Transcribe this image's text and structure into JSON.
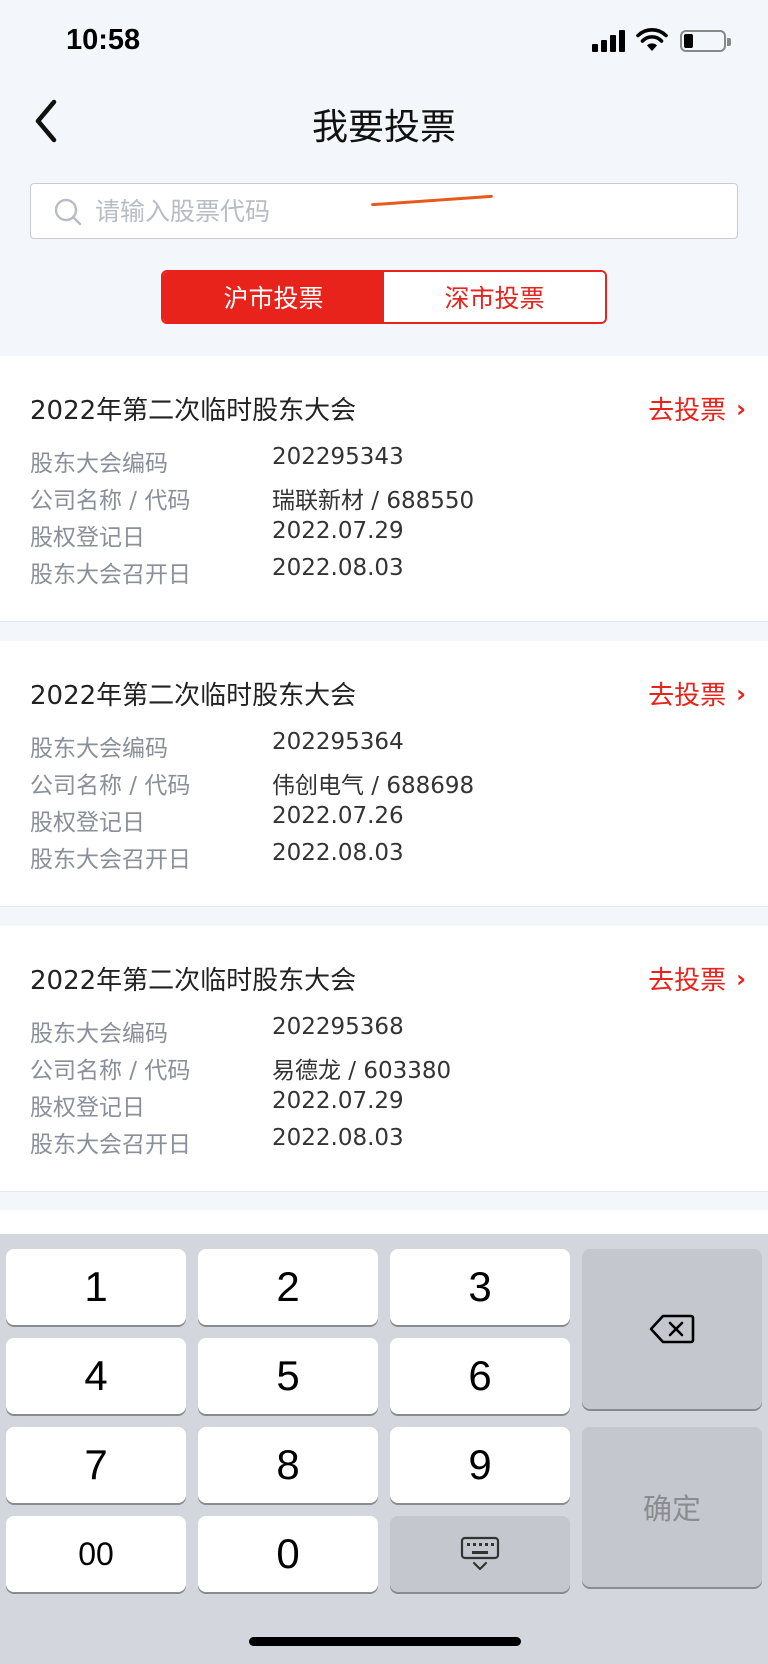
{
  "status_bar": {
    "time": "10:58"
  },
  "header": {
    "title": "我要投票"
  },
  "search": {
    "placeholder": "请输入股票代码",
    "value": ""
  },
  "tabs": [
    {
      "label": "沪市投票",
      "active": true
    },
    {
      "label": "深市投票",
      "active": false
    }
  ],
  "cards": [
    {
      "title": "2022年第二次临时股东大会",
      "action": "去投票",
      "rows": [
        {
          "key": "股东大会编码",
          "value": "202295343"
        },
        {
          "key": "公司名称 / 代码",
          "value": "瑞联新材 / 688550"
        },
        {
          "key": "股权登记日",
          "value": "2022.07.29"
        },
        {
          "key": "股东大会召开日",
          "value": "2022.08.03"
        }
      ]
    },
    {
      "title": "2022年第二次临时股东大会",
      "action": "去投票",
      "rows": [
        {
          "key": "股东大会编码",
          "value": "202295364"
        },
        {
          "key": "公司名称 / 代码",
          "value": "伟创电气 / 688698"
        },
        {
          "key": "股权登记日",
          "value": "2022.07.26"
        },
        {
          "key": "股东大会召开日",
          "value": "2022.08.03"
        }
      ]
    },
    {
      "title": "2022年第二次临时股东大会",
      "action": "去投票",
      "rows": [
        {
          "key": "股东大会编码",
          "value": "202295368"
        },
        {
          "key": "公司名称 / 代码",
          "value": "易德龙 / 603380"
        },
        {
          "key": "股权登记日",
          "value": "2022.07.29"
        },
        {
          "key": "股东大会召开日",
          "value": "2022.08.03"
        }
      ]
    }
  ],
  "keyboard": {
    "keys": [
      "1",
      "2",
      "3",
      "4",
      "5",
      "6",
      "7",
      "8",
      "9",
      "00",
      "0"
    ],
    "confirm_label": "确定"
  },
  "colors": {
    "accent": "#e8231c",
    "background": "#f3f6fa"
  },
  "icons": [
    "back-chevron-icon",
    "search-icon",
    "chevron-right-icon",
    "delete-backspace-icon",
    "keyboard-hide-icon"
  ]
}
